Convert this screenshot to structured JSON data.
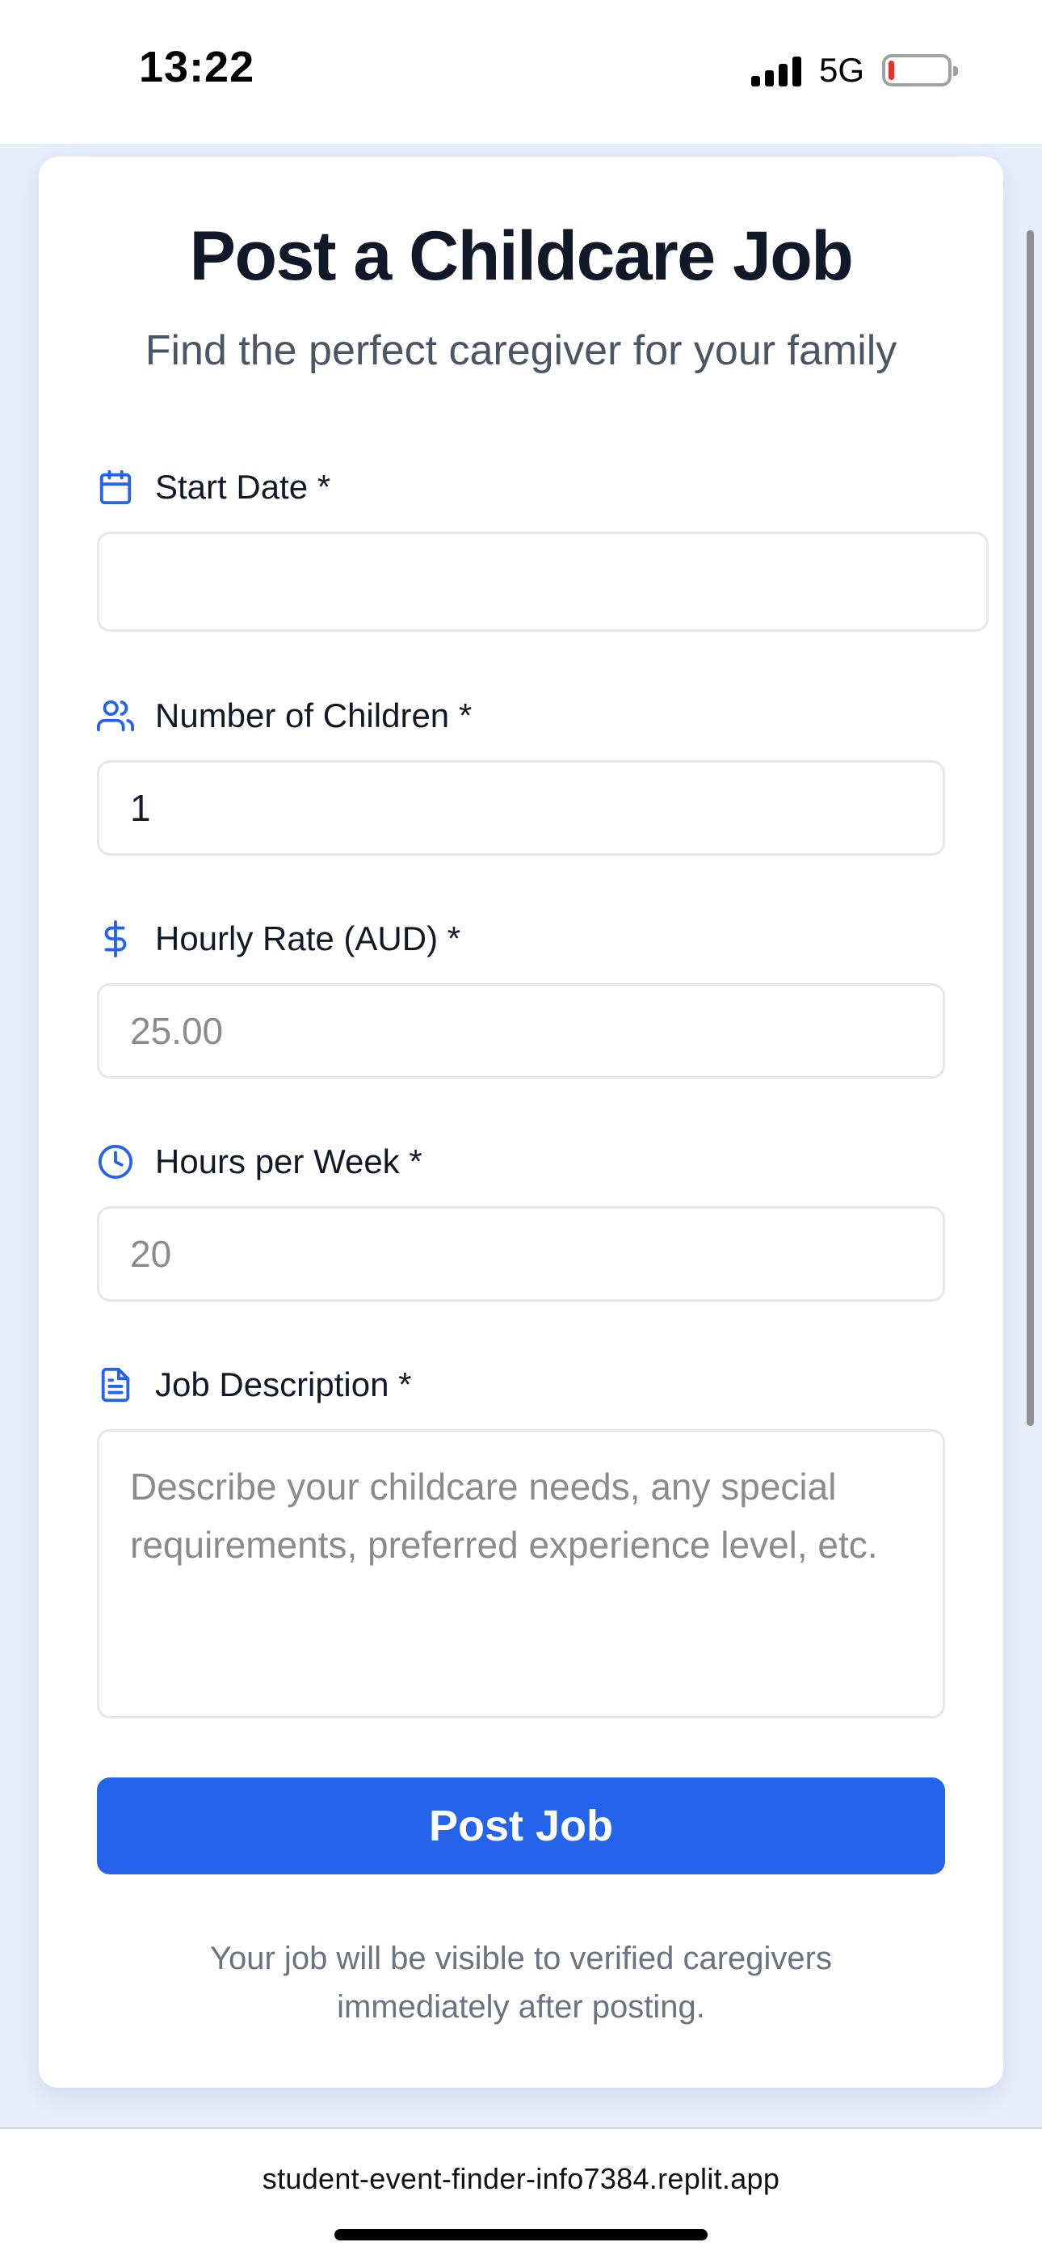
{
  "status_bar": {
    "time": "13:22",
    "network": "5G",
    "battery_level": 0.1,
    "battery_color": "#e5332a"
  },
  "page": {
    "title": "Post a Childcare Job",
    "subtitle": "Find the perfect caregiver for your family"
  },
  "form": {
    "start_date": {
      "label": "Start Date *",
      "value": "",
      "icon": "calendar-icon"
    },
    "children": {
      "label": "Number of Children *",
      "value": "1",
      "icon": "users-icon"
    },
    "rate": {
      "label": "Hourly Rate (AUD) *",
      "placeholder": "25.00",
      "icon": "dollar-icon"
    },
    "hours": {
      "label": "Hours per Week *",
      "placeholder": "20",
      "icon": "clock-icon"
    },
    "description": {
      "label": "Job Description *",
      "placeholder": "Describe your childcare needs, any special requirements, preferred experience level, etc.",
      "icon": "document-icon"
    },
    "submit_label": "Post Job",
    "footnote": "Your job will be visible to verified caregivers immediately after posting."
  },
  "browser": {
    "url": "student-event-finder-info7384.replit.app"
  },
  "colors": {
    "accent": "#2563eb",
    "page_background": "#e7edfb",
    "title": "#111827"
  }
}
